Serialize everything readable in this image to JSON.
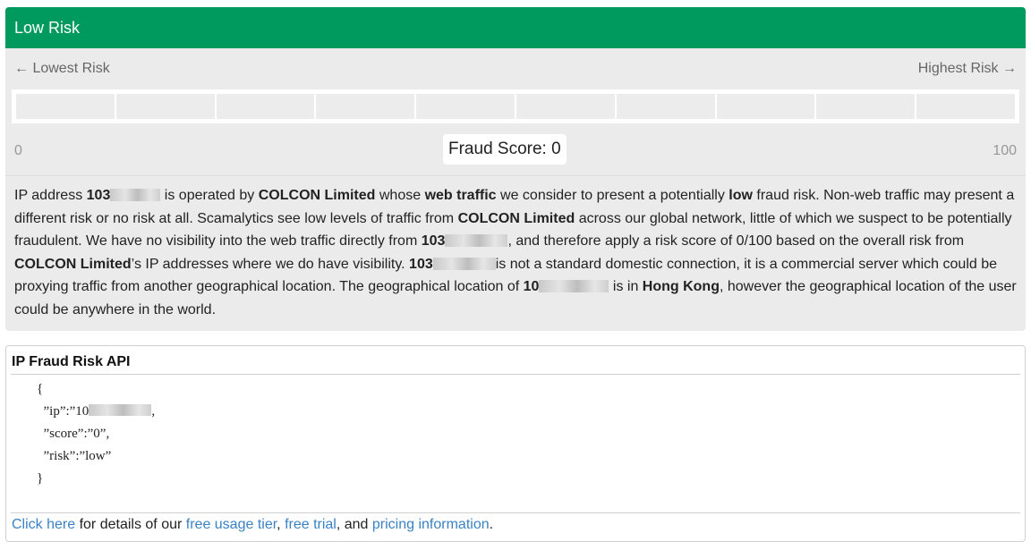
{
  "risk": {
    "header": "Low Risk",
    "lowest_label": "← Lowest Risk",
    "highest_label": "Highest Risk →",
    "score_min": "0",
    "score_max": "100",
    "score_text": "Fraud Score: 0",
    "score_value": 0,
    "segments": 10
  },
  "description": {
    "t1": "IP address ",
    "ip_a": "103",
    "t2": " is operated by ",
    "org1": "COLCON Limited",
    "t3": " whose ",
    "web_traffic": "web traffic",
    "t4": " we consider to present a potentially ",
    "low": "low",
    "t5": " fraud risk. Non-web traffic may present a different risk or no risk at all. Scamalytics see low levels of traffic from ",
    "org2": "COLCON Limited",
    "t6": " across our global network, little of which we suspect to be potentially fraudulent. We have no visibility into the web traffic directly from ",
    "ip_b": "103",
    "t7": ", and therefore apply a risk score of 0/100 based on the overall risk from ",
    "org3": "COLCON Limited",
    "t8": "’s IP addresses where we do have visibility. ",
    "ip_c": "103",
    "t9": "is not a standard domestic connection, it is a commercial server which could be proxying traffic from another geographical location. The geographical location of ",
    "ip_d": "10",
    "t10": " is in ",
    "location": "Hong Kong",
    "t11": ", however the geographical location of the user could be anywhere in the world."
  },
  "api": {
    "title": "IP Fraud Risk API",
    "code_open": "{",
    "code_ip": "  ”ip”:”10",
    "code_score": "  ”score”:”0”,",
    "code_risk": "  ”risk”:”low”",
    "code_close": "}",
    "footer_link1": "Click here",
    "footer_t1": " for details of our ",
    "footer_link2": "free usage tier",
    "footer_t2": ", ",
    "footer_link3": "free trial",
    "footer_t3": ", and ",
    "footer_link4": "pricing information",
    "footer_t4": "."
  }
}
